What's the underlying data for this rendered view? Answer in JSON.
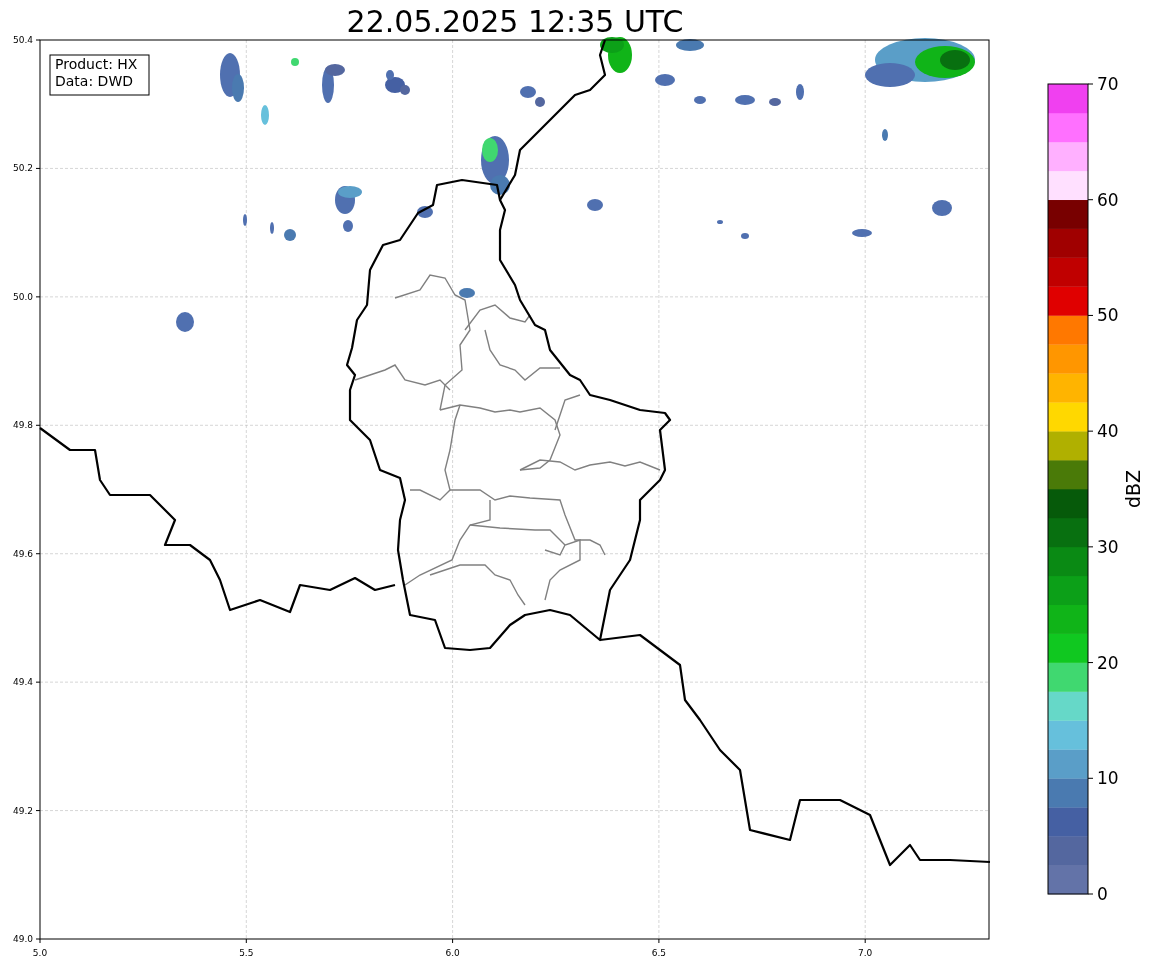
{
  "title": "22.05.2025 12:35 UTC",
  "info_box": [
    "Product: HX",
    "Data: DWD"
  ],
  "map": {
    "xticks": [
      "5.0",
      "5.5",
      "6.0",
      "6.5",
      "7.0"
    ],
    "yticks": [
      "50.4",
      "50.2",
      "50.0",
      "49.8",
      "49.6",
      "49.4",
      "49.2",
      "49.0"
    ]
  },
  "colorbar": {
    "label": "dBZ",
    "ticks": [
      "70",
      "60",
      "50",
      "40",
      "30",
      "20",
      "10",
      "0"
    ],
    "bands": [
      {
        "color": "#6373a8"
      },
      {
        "color": "#54679f"
      },
      {
        "color": "#4560a3"
      },
      {
        "color": "#4a7ab0"
      },
      {
        "color": "#5a9ec8"
      },
      {
        "color": "#66c0dc"
      },
      {
        "color": "#66d8c8"
      },
      {
        "color": "#40d870"
      },
      {
        "color": "#10c820"
      },
      {
        "color": "#10b418"
      },
      {
        "color": "#0ca018"
      },
      {
        "color": "#0a8a14"
      },
      {
        "color": "#087010"
      },
      {
        "color": "#065a0a"
      },
      {
        "color": "#4a7a08"
      },
      {
        "color": "#b0b000"
      },
      {
        "color": "#ffd800"
      },
      {
        "color": "#ffb400"
      },
      {
        "color": "#ff9600"
      },
      {
        "color": "#ff7800"
      },
      {
        "color": "#e00000"
      },
      {
        "color": "#c00000"
      },
      {
        "color": "#a00000"
      },
      {
        "color": "#780000"
      },
      {
        "color": "#ffe0ff"
      },
      {
        "color": "#ffb0ff"
      },
      {
        "color": "#ff70ff"
      },
      {
        "color": "#f040f0"
      }
    ]
  }
}
